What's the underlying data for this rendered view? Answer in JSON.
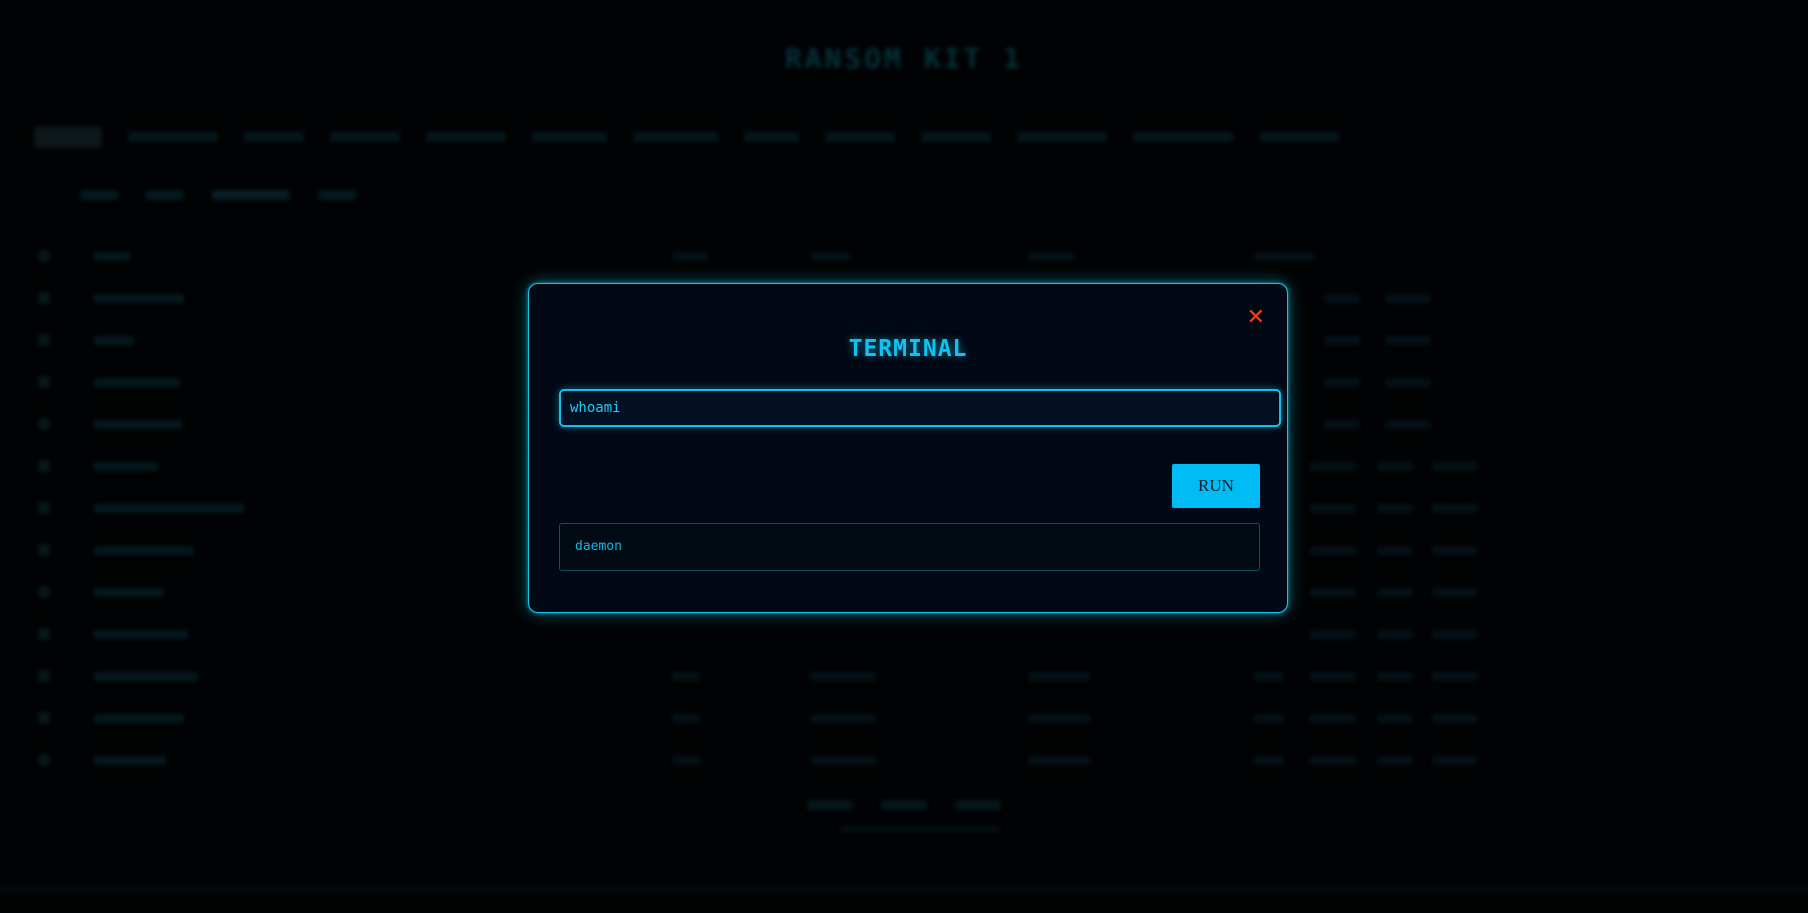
{
  "background": {
    "title": "RANSOM KIT 1"
  },
  "terminal_modal": {
    "title": "TERMINAL",
    "close_icon": "close-x-icon",
    "command_value": "whoami",
    "run_label": "RUN",
    "output": "daemon"
  },
  "colors": {
    "accent": "#10c2ef",
    "close": "#ff3b14",
    "run_button": "#00bcf5",
    "background": "#010406"
  }
}
